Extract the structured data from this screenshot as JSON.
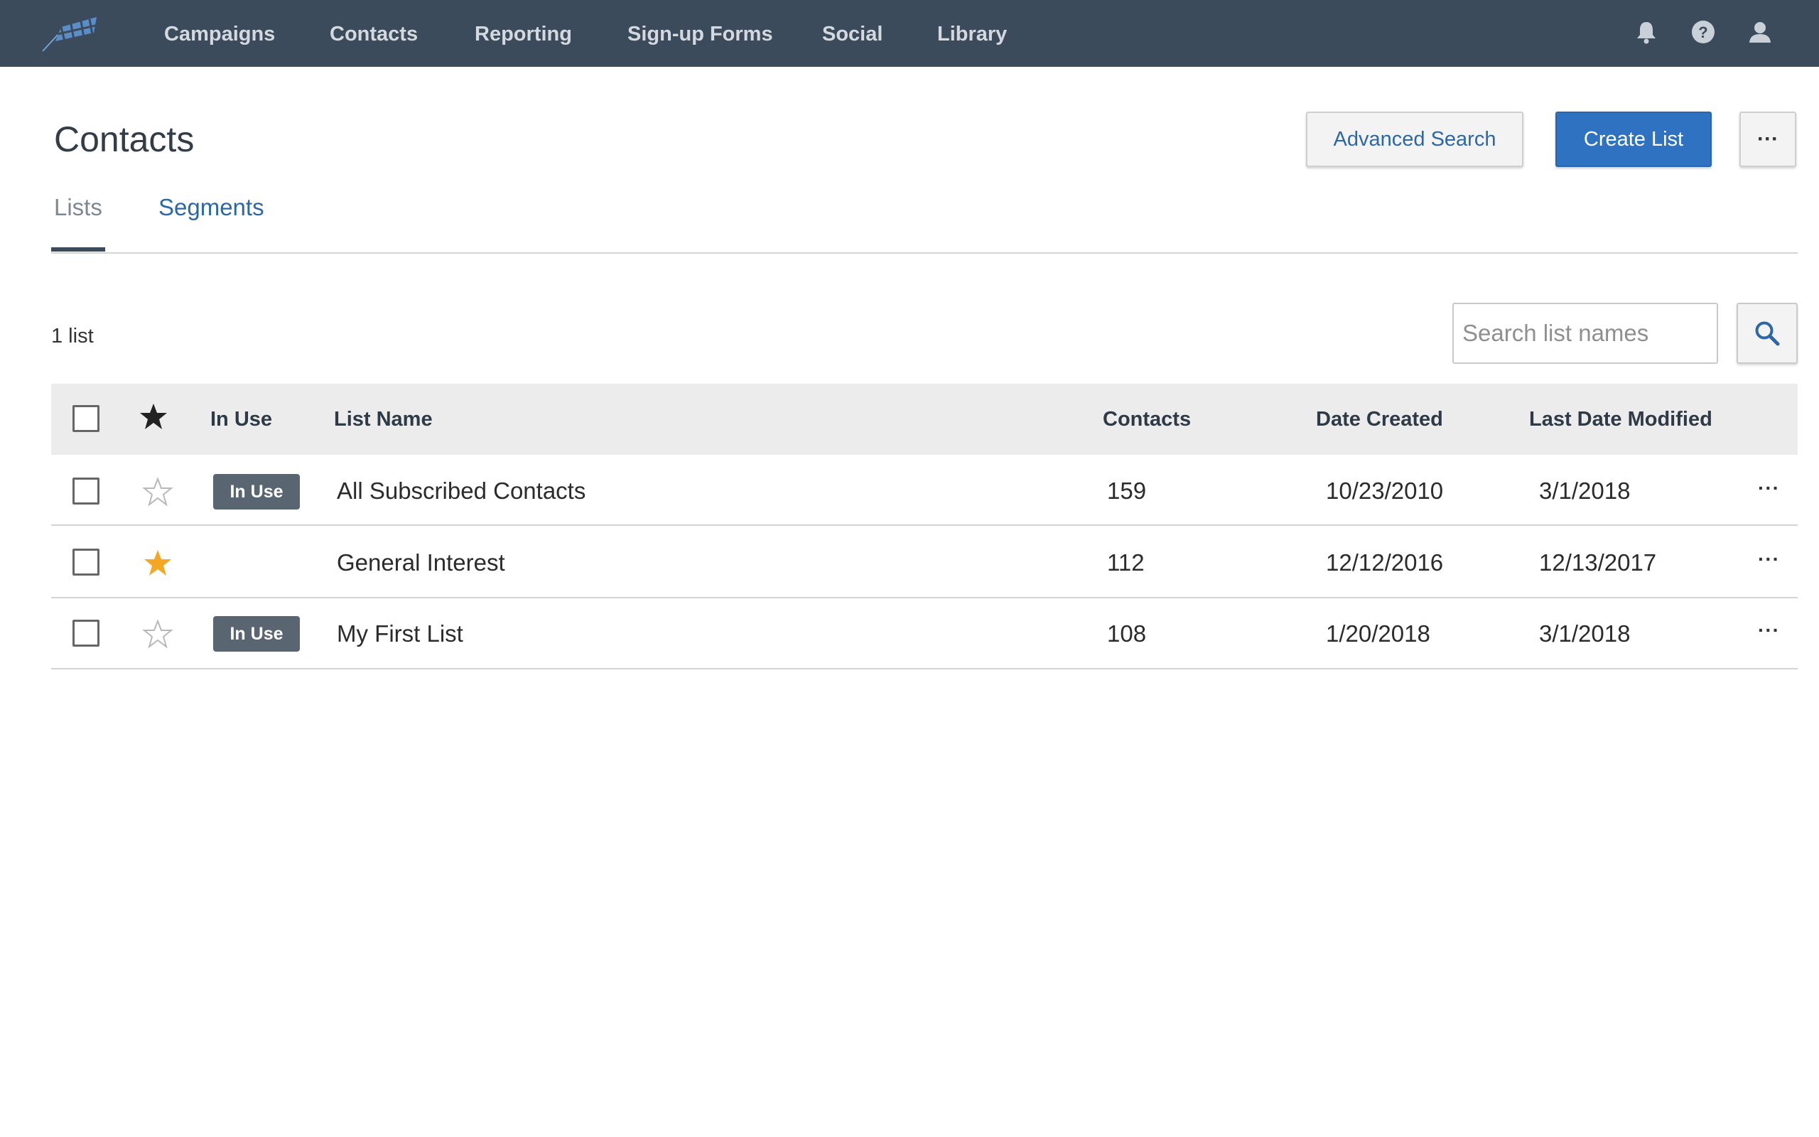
{
  "nav": {
    "items": [
      {
        "label": "Campaigns"
      },
      {
        "label": "Contacts"
      },
      {
        "label": "Reporting"
      },
      {
        "label": "Sign-up Forms"
      },
      {
        "label": "Social"
      },
      {
        "label": "Library"
      }
    ],
    "icons": [
      "bell-icon",
      "help-icon",
      "user-icon"
    ],
    "background_color": "#3c4b5c"
  },
  "header": {
    "title": "Contacts",
    "advanced_search_label": "Advanced Search",
    "create_list_label": "Create List",
    "more_label": "···",
    "accent_color": "#2f72c1"
  },
  "tabs": [
    {
      "label": "Lists",
      "active": true
    },
    {
      "label": "Segments",
      "active": false
    }
  ],
  "toolbar": {
    "count_text": "1 list",
    "search_placeholder": "Search list names",
    "search_value": ""
  },
  "table": {
    "columns": [
      "In Use",
      "List Name",
      "Contacts",
      "Date Created",
      "Last Date Modified"
    ],
    "rows": [
      {
        "starred": false,
        "in_use": "In Use",
        "name": "All Subscribed Contacts",
        "contacts": "159",
        "created": "10/23/2010",
        "modified": "3/1/2018"
      },
      {
        "starred": true,
        "in_use": "",
        "name": "General Interest",
        "contacts": "112",
        "created": "12/12/2016",
        "modified": "12/13/2017"
      },
      {
        "starred": false,
        "in_use": "In Use",
        "name": "My First List",
        "contacts": "108",
        "created": "1/20/2018",
        "modified": "3/1/2018"
      }
    ],
    "row_more_label": "···",
    "star_filled_color": "#f5a623"
  }
}
